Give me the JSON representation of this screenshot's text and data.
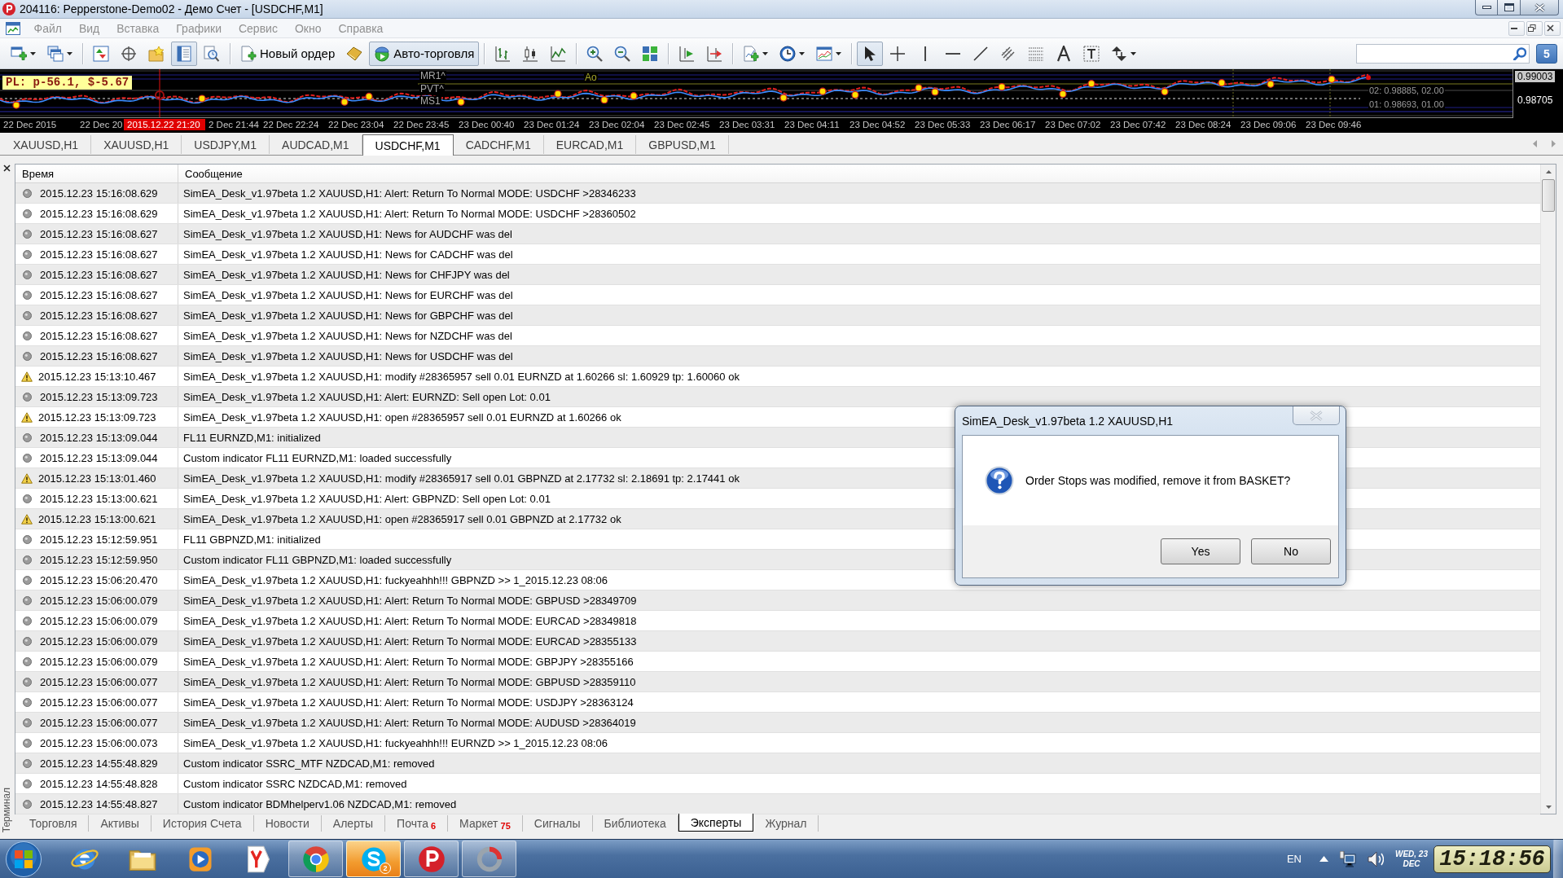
{
  "window": {
    "title": "204116: Pepperstone-Demo02 - Демо Счет - [USDCHF,M1]"
  },
  "menu": {
    "disabled": true,
    "items": [
      "Файл",
      "Вид",
      "Вставка",
      "Графики",
      "Сервис",
      "Окно",
      "Справка"
    ]
  },
  "toolbar": {
    "items": [
      {
        "pressed": false
      },
      {
        "pressed": false
      },
      {
        "pressed": false
      },
      {
        "pressed": false
      },
      {
        "pressed": false
      },
      {
        "pressed": true
      },
      {
        "pressed": false
      },
      {
        "label": "Новый ордер",
        "pressed": false
      },
      {
        "pressed": false
      },
      {
        "label": "Авто-торговля",
        "pressed": true
      },
      {
        "pressed": false
      },
      {
        "pressed": false
      },
      {
        "pressed": false
      },
      {
        "pressed": false
      },
      {
        "pressed": false
      },
      {
        "pressed": false
      },
      {
        "pressed": false
      },
      {
        "pressed": false
      },
      {
        "pressed": false
      },
      {
        "pressed": false
      },
      {
        "pressed": false
      },
      {
        "pressed": true
      },
      {
        "pressed": false
      },
      {
        "pressed": false
      },
      {
        "pressed": false
      },
      {
        "pressed": false
      },
      {
        "pressed": false
      },
      {
        "pressed": false
      },
      {
        "pressed": false
      },
      {
        "pressed": false
      },
      {
        "pressed": false
      }
    ],
    "messages_badge": "5"
  },
  "chart": {
    "pl_label": "PL: p-56.1, $-5.67",
    "levels": [
      "MR1^",
      "PVT^",
      "MS1"
    ],
    "indicator_label": "Ao",
    "level_notes": [
      "02: 0.98885, 02.00",
      "01: 0.98693, 01.00"
    ],
    "prices": [
      {
        "text": "0.99003",
        "kind": "current"
      },
      {
        "text": "0.98705",
        "kind": "scale"
      }
    ],
    "cursor_time": "2015.12.22 21:20",
    "time_axis": [
      "22 Dec 2015",
      "22 Dec 20",
      "2 Dec 21:44",
      "22 Dec 22:24",
      "22 Dec 23:04",
      "22 Dec 23:45",
      "23 Dec 00:40",
      "23 Dec 01:24",
      "23 Dec 02:04",
      "23 Dec 02:45",
      "23 Dec 03:31",
      "23 Dec 04:11",
      "23 Dec 04:52",
      "23 Dec 05:33",
      "23 Dec 06:17",
      "23 Dec 07:02",
      "23 Dec 07:42",
      "23 Dec 08:24",
      "23 Dec 09:06",
      "23 Dec 09:46"
    ]
  },
  "chart_tabs": [
    {
      "label": "XAUUSD,H1",
      "selected": false
    },
    {
      "label": "XAUUSD,H1",
      "selected": false
    },
    {
      "label": "USDJPY,M1",
      "selected": false
    },
    {
      "label": "AUDCAD,M1",
      "selected": false
    },
    {
      "label": "USDCHF,M1",
      "selected": true
    },
    {
      "label": "CADCHF,M1",
      "selected": false
    },
    {
      "label": "EURCAD,M1",
      "selected": false
    },
    {
      "label": "GBPUSD,M1",
      "selected": false
    }
  ],
  "terminal": {
    "title": "Терминал",
    "columns": [
      "Время",
      "Сообщение"
    ],
    "rows": [
      {
        "kind": "info",
        "time": "2015.12.23 15:16:08.629",
        "message": "SimEA_Desk_v1.97beta 1.2 XAUUSD,H1: Alert: Return To Normal MODE: USDCHF >28346233"
      },
      {
        "kind": "info",
        "time": "2015.12.23 15:16:08.629",
        "message": "SimEA_Desk_v1.97beta 1.2 XAUUSD,H1: Alert: Return To Normal MODE: USDCHF >28360502"
      },
      {
        "kind": "info",
        "time": "2015.12.23 15:16:08.627",
        "message": "SimEA_Desk_v1.97beta 1.2 XAUUSD,H1: News for AUDCHF was del"
      },
      {
        "kind": "info",
        "time": "2015.12.23 15:16:08.627",
        "message": "SimEA_Desk_v1.97beta 1.2 XAUUSD,H1: News for CADCHF was del"
      },
      {
        "kind": "info",
        "time": "2015.12.23 15:16:08.627",
        "message": "SimEA_Desk_v1.97beta 1.2 XAUUSD,H1: News for CHFJPY was del"
      },
      {
        "kind": "info",
        "time": "2015.12.23 15:16:08.627",
        "message": "SimEA_Desk_v1.97beta 1.2 XAUUSD,H1: News for EURCHF was del"
      },
      {
        "kind": "info",
        "time": "2015.12.23 15:16:08.627",
        "message": "SimEA_Desk_v1.97beta 1.2 XAUUSD,H1: News for GBPCHF was del"
      },
      {
        "kind": "info",
        "time": "2015.12.23 15:16:08.627",
        "message": "SimEA_Desk_v1.97beta 1.2 XAUUSD,H1: News for NZDCHF was del"
      },
      {
        "kind": "info",
        "time": "2015.12.23 15:16:08.627",
        "message": "SimEA_Desk_v1.97beta 1.2 XAUUSD,H1: News for USDCHF was del"
      },
      {
        "kind": "warning",
        "time": "2015.12.23 15:13:10.467",
        "message": "SimEA_Desk_v1.97beta 1.2 XAUUSD,H1: modify #28365957 sell 0.01 EURNZD at 1.60266 sl: 1.60929 tp: 1.60060 ok"
      },
      {
        "kind": "info",
        "time": "2015.12.23 15:13:09.723",
        "message": "SimEA_Desk_v1.97beta 1.2 XAUUSD,H1: Alert: EURNZD: Sell open Lot: 0.01"
      },
      {
        "kind": "warning",
        "time": "2015.12.23 15:13:09.723",
        "message": "SimEA_Desk_v1.97beta 1.2 XAUUSD,H1: open #28365957 sell 0.01 EURNZD at 1.60266 ok"
      },
      {
        "kind": "info",
        "time": "2015.12.23 15:13:09.044",
        "message": "FL11 EURNZD,M1: initialized"
      },
      {
        "kind": "info",
        "time": "2015.12.23 15:13:09.044",
        "message": "Custom indicator FL11 EURNZD,M1: loaded successfully"
      },
      {
        "kind": "warning",
        "time": "2015.12.23 15:13:01.460",
        "message": "SimEA_Desk_v1.97beta 1.2 XAUUSD,H1: modify #28365917 sell 0.01 GBPNZD at 2.17732 sl: 2.18691 tp: 2.17441 ok"
      },
      {
        "kind": "info",
        "time": "2015.12.23 15:13:00.621",
        "message": "SimEA_Desk_v1.97beta 1.2 XAUUSD,H1: Alert: GBPNZD: Sell open Lot: 0.01"
      },
      {
        "kind": "warning",
        "time": "2015.12.23 15:13:00.621",
        "message": "SimEA_Desk_v1.97beta 1.2 XAUUSD,H1: open #28365917 sell 0.01 GBPNZD at 2.17732 ok"
      },
      {
        "kind": "info",
        "time": "2015.12.23 15:12:59.951",
        "message": "FL11 GBPNZD,M1: initialized"
      },
      {
        "kind": "info",
        "time": "2015.12.23 15:12:59.950",
        "message": "Custom indicator FL11 GBPNZD,M1: loaded successfully"
      },
      {
        "kind": "info",
        "time": "2015.12.23 15:06:20.470",
        "message": "SimEA_Desk_v1.97beta 1.2 XAUUSD,H1: fuckyeahhh!!! GBPNZD >> 1_2015.12.23 08:06"
      },
      {
        "kind": "info",
        "time": "2015.12.23 15:06:00.079",
        "message": "SimEA_Desk_v1.97beta 1.2 XAUUSD,H1: Alert: Return To Normal MODE: GBPUSD >28349709"
      },
      {
        "kind": "info",
        "time": "2015.12.23 15:06:00.079",
        "message": "SimEA_Desk_v1.97beta 1.2 XAUUSD,H1: Alert: Return To Normal MODE: EURCAD >28349818"
      },
      {
        "kind": "info",
        "time": "2015.12.23 15:06:00.079",
        "message": "SimEA_Desk_v1.97beta 1.2 XAUUSD,H1: Alert: Return To Normal MODE: EURCAD >28355133"
      },
      {
        "kind": "info",
        "time": "2015.12.23 15:06:00.079",
        "message": "SimEA_Desk_v1.97beta 1.2 XAUUSD,H1: Alert: Return To Normal MODE: GBPJPY >28355166"
      },
      {
        "kind": "info",
        "time": "2015.12.23 15:06:00.077",
        "message": "SimEA_Desk_v1.97beta 1.2 XAUUSD,H1: Alert: Return To Normal MODE: GBPUSD >28359110"
      },
      {
        "kind": "info",
        "time": "2015.12.23 15:06:00.077",
        "message": "SimEA_Desk_v1.97beta 1.2 XAUUSD,H1: Alert: Return To Normal MODE: USDJPY >28363124"
      },
      {
        "kind": "info",
        "time": "2015.12.23 15:06:00.077",
        "message": "SimEA_Desk_v1.97beta 1.2 XAUUSD,H1: Alert: Return To Normal MODE: AUDUSD >28364019"
      },
      {
        "kind": "info",
        "time": "2015.12.23 15:06:00.073",
        "message": "SimEA_Desk_v1.97beta 1.2 XAUUSD,H1: fuckyeahhh!!! EURNZD >> 1_2015.12.23 08:06"
      },
      {
        "kind": "info",
        "time": "2015.12.23 14:55:48.829",
        "message": "Custom indicator SSRC_MTF NZDCAD,M1: removed"
      },
      {
        "kind": "info",
        "time": "2015.12.23 14:55:48.828",
        "message": "Custom indicator SSRC NZDCAD,M1: removed"
      },
      {
        "kind": "info",
        "time": "2015.12.23 14:55:48.827",
        "message": "Custom indicator BDMhelperv1.06 NZDCAD,M1: removed"
      }
    ],
    "tabs": [
      {
        "label": "Торговля",
        "selected": false
      },
      {
        "label": "Активы",
        "selected": false
      },
      {
        "label": "История Счета",
        "selected": false
      },
      {
        "label": "Новости",
        "selected": false
      },
      {
        "label": "Алерты",
        "selected": false
      },
      {
        "label": "Почта",
        "badge": "6",
        "selected": false
      },
      {
        "label": "Маркет",
        "badge": "75",
        "selected": false
      },
      {
        "label": "Сигналы",
        "selected": false
      },
      {
        "label": "Библиотека",
        "selected": false
      },
      {
        "label": "Эксперты",
        "selected": true
      },
      {
        "label": "Журнал",
        "selected": false
      }
    ]
  },
  "dialog": {
    "title": "SimEA_Desk_v1.97beta 1.2 XAUUSD,H1",
    "close_button": {
      "disabled": true
    },
    "message": "Order Stops was modified, remove it from BASKET?",
    "buttons": [
      "Yes",
      "No"
    ]
  },
  "taskbar": {
    "apps": [
      {
        "running": false,
        "highlighted": false
      },
      {
        "running": false,
        "highlighted": false
      },
      {
        "running": false,
        "highlighted": false
      },
      {
        "running": false,
        "highlighted": false
      },
      {
        "running": true,
        "highlighted": false
      },
      {
        "running": true,
        "highlighted": true,
        "badge": "2"
      },
      {
        "running": true,
        "highlighted": false
      },
      {
        "running": true,
        "highlighted": false
      }
    ],
    "language": "EN",
    "date_lines": [
      "WED, 23",
      "DEC"
    ],
    "clock": "15:18:56"
  }
}
